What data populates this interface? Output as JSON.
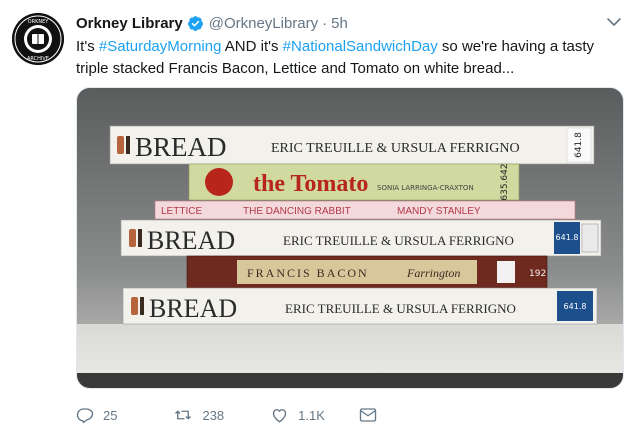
{
  "account": {
    "name": "Orkney Library",
    "handle": "@OrkneyLibrary",
    "separator": "·",
    "time": "5h",
    "avatar_ring_text": "ORKNEY LIBRARY & ARCHIVE"
  },
  "tweet": {
    "segments": [
      {
        "text": "It's ",
        "type": "text"
      },
      {
        "text": "#SaturdayMorning",
        "type": "hashtag"
      },
      {
        "text": " AND it's ",
        "type": "text"
      },
      {
        "text": "#NationalSandwichDay",
        "type": "hashtag"
      },
      {
        "text": " so we're having a tasty triple stacked Francis Bacon, Lettice and Tomato on white bread...",
        "type": "text"
      }
    ]
  },
  "media": {
    "book_spines": {
      "bread_title": "BREAD",
      "bread_authors": "ERIC TREUILLE & URSULA FERRIGNO",
      "bread_call_number_1": "641.8",
      "bread_call_number_2": "641.8",
      "bread_call_number_3": "641.8",
      "tomato_title": "the Tomato",
      "tomato_authors": "SONIA LARRINGA-CRAXTON",
      "tomato_call_number": "635.642",
      "lettice_title": "LETTICE",
      "lettice_subtitle": "THE DANCING RABBIT",
      "lettice_author": "MANDY STANLEY",
      "bacon_title": "FRANCIS BACON",
      "bacon_author": "Farrington",
      "bacon_call_number": "192"
    }
  },
  "actions": {
    "reply_count": "25",
    "retweet_count": "238",
    "like_count": "1.1K"
  },
  "colors": {
    "hashtag": "#1da1f2",
    "verified": "#1da1f2",
    "secondary_text": "#657786"
  }
}
